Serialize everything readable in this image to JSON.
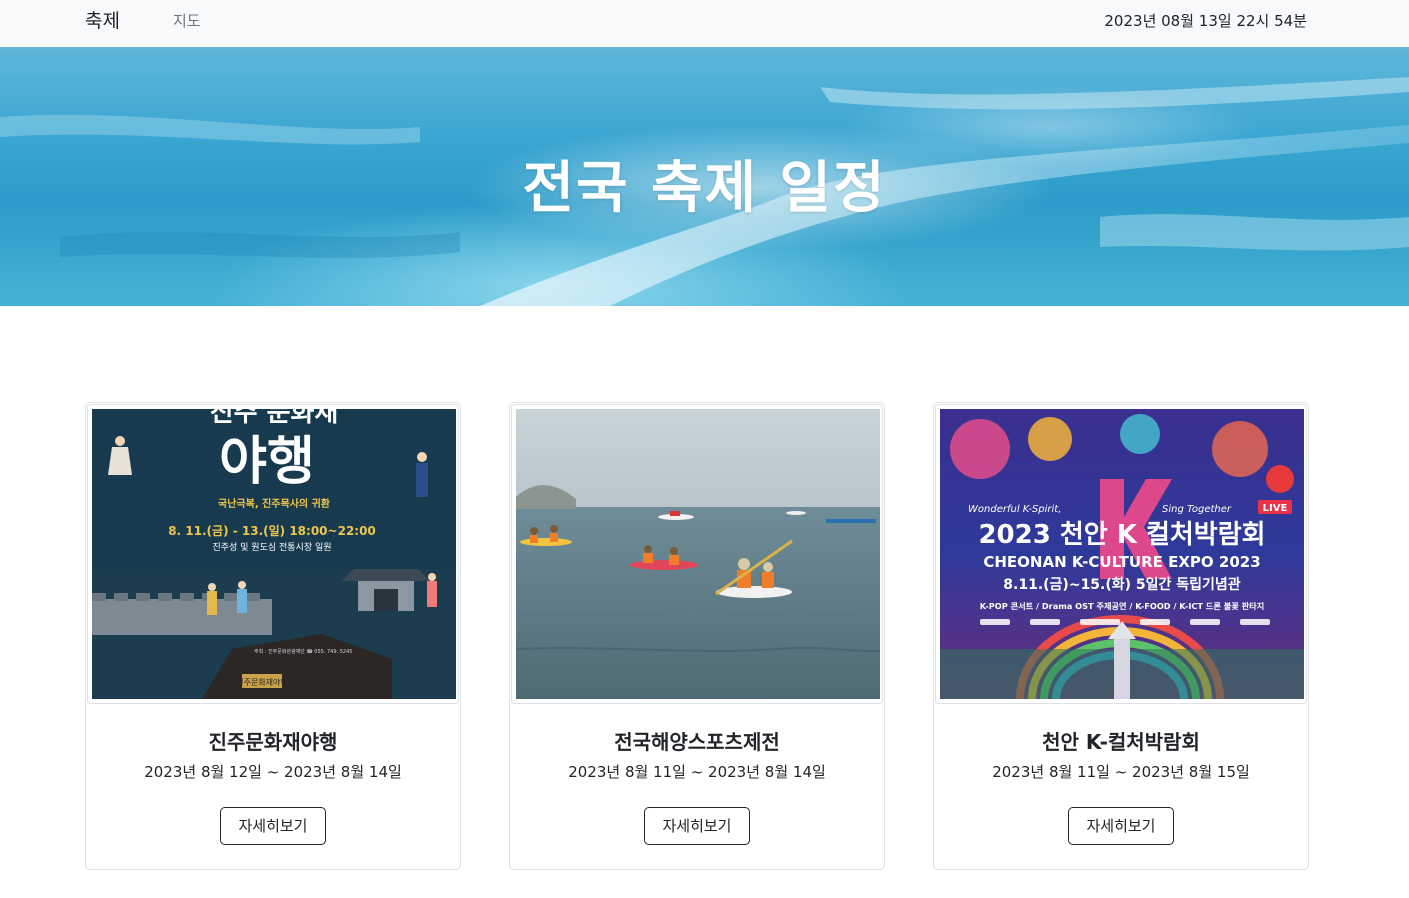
{
  "navbar": {
    "brand": "축제",
    "map_link": "지도",
    "datetime": "2023년 08월 13일 22시 54분"
  },
  "hero": {
    "title": "전국 축제 일정"
  },
  "cards": [
    {
      "title": "진주문화재야행",
      "dates": "2023년 8월 12일 ~ 2023년 8월 14일",
      "button": "자세히보기",
      "poster": {
        "headline": "야행",
        "top": "진주 문화재",
        "tagline": "국난극복, 진주목사의 귀환",
        "schedule": "8. 11.(금) - 13.(일) 18:00~22:00",
        "place": "진주성 및 원도심 전통시장 일원",
        "footer_left": "진주문화재야행",
        "footer_right": "주최 : 진주문화관광재단 ☎ 055. 749. 5245"
      }
    },
    {
      "title": "전국해양스포츠제전",
      "dates": "2023년 8월 11일 ~ 2023년 8월 14일",
      "button": "자세히보기"
    },
    {
      "title": "천안 K-컬처박람회",
      "dates": "2023년 8월 11일 ~ 2023년 8월 15일",
      "button": "자세히보기",
      "poster": {
        "script_left": "Wonderful K-Spirit,",
        "script_right": "Sing Together",
        "live_badge": "LIVE",
        "headline": "2023 천안 K 컬처박람회",
        "english": "CHEONAN K-CULTURE EXPO 2023",
        "schedule": "8.11.(금)~15.(화) 5일간 독립기념관",
        "program": "K-POP 콘서트 / Drama OST 주제공연 / K-FOOD / K-ICT 드론 불꽃 판타지"
      }
    }
  ]
}
